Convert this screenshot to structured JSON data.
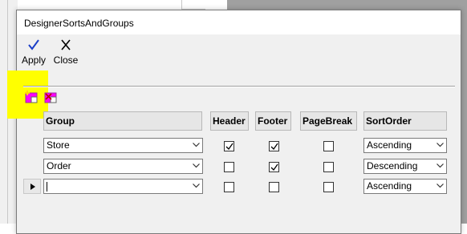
{
  "window": {
    "title": "DesignerSortsAndGroups"
  },
  "toolbar": {
    "apply_label": "Apply",
    "close_label": "Close",
    "apply_icon": "checkmark-icon",
    "close_icon": "x-icon",
    "apply_color": "#1a3ec8"
  },
  "group_tools": {
    "add_icon": "add-group-icon",
    "delete_icon": "delete-group-icon",
    "highlight_color": "#ffff00"
  },
  "grid": {
    "columns": [
      "Group",
      "Header",
      "Footer",
      "PageBreak",
      "SortOrder"
    ],
    "rows": [
      {
        "group": "Store",
        "header": true,
        "footer": true,
        "pagebreak": false,
        "sort_order": "Ascending",
        "current": false
      },
      {
        "group": "Order",
        "header": false,
        "footer": true,
        "pagebreak": false,
        "sort_order": "Descending",
        "current": false
      },
      {
        "group": "",
        "header": false,
        "footer": false,
        "pagebreak": false,
        "sort_order": "Ascending",
        "current": true
      }
    ]
  }
}
